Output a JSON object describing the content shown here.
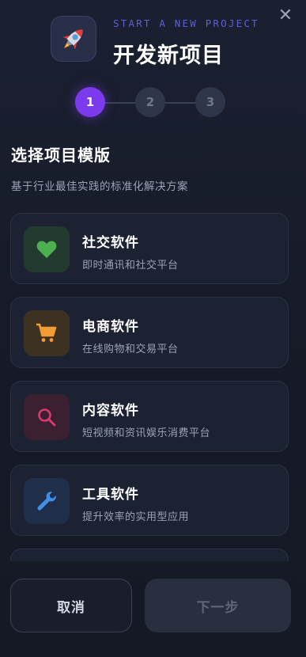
{
  "header": {
    "subtitle": "START A NEW PROJECT",
    "title": "开发新项目",
    "logo_icon": "rocket-icon",
    "close_label": "✕"
  },
  "stepper": {
    "current": 1,
    "steps": [
      "1",
      "2",
      "3"
    ],
    "active_color": "#7c3aed"
  },
  "section": {
    "title": "选择项目模版",
    "description": "基于行业最佳实践的标准化解决方案"
  },
  "templates": [
    {
      "name": "社交软件",
      "description": "即时通讯和社交平台",
      "icon": "heart-icon",
      "color": "#4caf50"
    },
    {
      "name": "电商软件",
      "description": "在线购物和交易平台",
      "icon": "cart-icon",
      "color": "#f39c35"
    },
    {
      "name": "内容软件",
      "description": "短视频和资讯娱乐消费平台",
      "icon": "search-icon",
      "color": "#d63a6e"
    },
    {
      "name": "工具软件",
      "description": "提升效率的实用型应用",
      "icon": "wrench-icon",
      "color": "#3f8fe8"
    }
  ],
  "footer": {
    "cancel_label": "取消",
    "next_label": "下一步"
  }
}
